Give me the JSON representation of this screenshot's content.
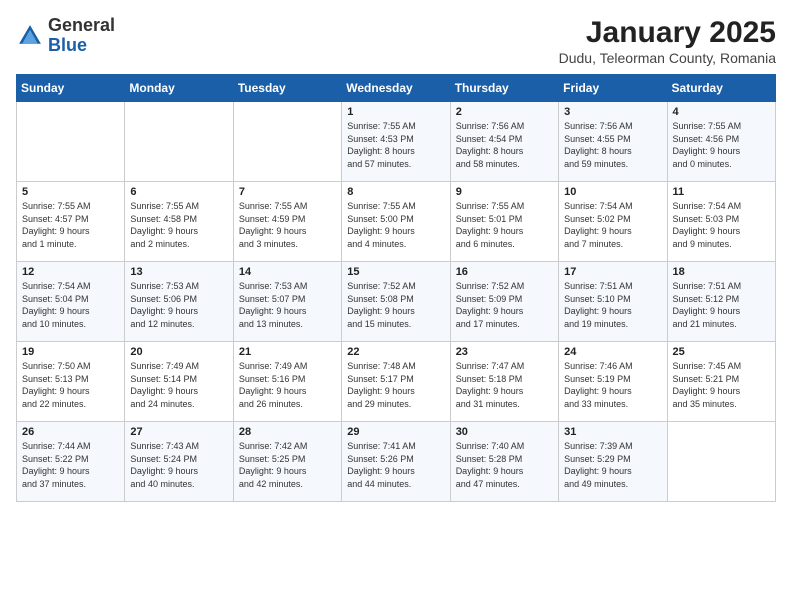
{
  "logo": {
    "general": "General",
    "blue": "Blue"
  },
  "header": {
    "month": "January 2025",
    "location": "Dudu, Teleorman County, Romania"
  },
  "days_of_week": [
    "Sunday",
    "Monday",
    "Tuesday",
    "Wednesday",
    "Thursday",
    "Friday",
    "Saturday"
  ],
  "weeks": [
    [
      {
        "day": "",
        "info": ""
      },
      {
        "day": "",
        "info": ""
      },
      {
        "day": "",
        "info": ""
      },
      {
        "day": "1",
        "info": "Sunrise: 7:55 AM\nSunset: 4:53 PM\nDaylight: 8 hours\nand 57 minutes."
      },
      {
        "day": "2",
        "info": "Sunrise: 7:56 AM\nSunset: 4:54 PM\nDaylight: 8 hours\nand 58 minutes."
      },
      {
        "day": "3",
        "info": "Sunrise: 7:56 AM\nSunset: 4:55 PM\nDaylight: 8 hours\nand 59 minutes."
      },
      {
        "day": "4",
        "info": "Sunrise: 7:55 AM\nSunset: 4:56 PM\nDaylight: 9 hours\nand 0 minutes."
      }
    ],
    [
      {
        "day": "5",
        "info": "Sunrise: 7:55 AM\nSunset: 4:57 PM\nDaylight: 9 hours\nand 1 minute."
      },
      {
        "day": "6",
        "info": "Sunrise: 7:55 AM\nSunset: 4:58 PM\nDaylight: 9 hours\nand 2 minutes."
      },
      {
        "day": "7",
        "info": "Sunrise: 7:55 AM\nSunset: 4:59 PM\nDaylight: 9 hours\nand 3 minutes."
      },
      {
        "day": "8",
        "info": "Sunrise: 7:55 AM\nSunset: 5:00 PM\nDaylight: 9 hours\nand 4 minutes."
      },
      {
        "day": "9",
        "info": "Sunrise: 7:55 AM\nSunset: 5:01 PM\nDaylight: 9 hours\nand 6 minutes."
      },
      {
        "day": "10",
        "info": "Sunrise: 7:54 AM\nSunset: 5:02 PM\nDaylight: 9 hours\nand 7 minutes."
      },
      {
        "day": "11",
        "info": "Sunrise: 7:54 AM\nSunset: 5:03 PM\nDaylight: 9 hours\nand 9 minutes."
      }
    ],
    [
      {
        "day": "12",
        "info": "Sunrise: 7:54 AM\nSunset: 5:04 PM\nDaylight: 9 hours\nand 10 minutes."
      },
      {
        "day": "13",
        "info": "Sunrise: 7:53 AM\nSunset: 5:06 PM\nDaylight: 9 hours\nand 12 minutes."
      },
      {
        "day": "14",
        "info": "Sunrise: 7:53 AM\nSunset: 5:07 PM\nDaylight: 9 hours\nand 13 minutes."
      },
      {
        "day": "15",
        "info": "Sunrise: 7:52 AM\nSunset: 5:08 PM\nDaylight: 9 hours\nand 15 minutes."
      },
      {
        "day": "16",
        "info": "Sunrise: 7:52 AM\nSunset: 5:09 PM\nDaylight: 9 hours\nand 17 minutes."
      },
      {
        "day": "17",
        "info": "Sunrise: 7:51 AM\nSunset: 5:10 PM\nDaylight: 9 hours\nand 19 minutes."
      },
      {
        "day": "18",
        "info": "Sunrise: 7:51 AM\nSunset: 5:12 PM\nDaylight: 9 hours\nand 21 minutes."
      }
    ],
    [
      {
        "day": "19",
        "info": "Sunrise: 7:50 AM\nSunset: 5:13 PM\nDaylight: 9 hours\nand 22 minutes."
      },
      {
        "day": "20",
        "info": "Sunrise: 7:49 AM\nSunset: 5:14 PM\nDaylight: 9 hours\nand 24 minutes."
      },
      {
        "day": "21",
        "info": "Sunrise: 7:49 AM\nSunset: 5:16 PM\nDaylight: 9 hours\nand 26 minutes."
      },
      {
        "day": "22",
        "info": "Sunrise: 7:48 AM\nSunset: 5:17 PM\nDaylight: 9 hours\nand 29 minutes."
      },
      {
        "day": "23",
        "info": "Sunrise: 7:47 AM\nSunset: 5:18 PM\nDaylight: 9 hours\nand 31 minutes."
      },
      {
        "day": "24",
        "info": "Sunrise: 7:46 AM\nSunset: 5:19 PM\nDaylight: 9 hours\nand 33 minutes."
      },
      {
        "day": "25",
        "info": "Sunrise: 7:45 AM\nSunset: 5:21 PM\nDaylight: 9 hours\nand 35 minutes."
      }
    ],
    [
      {
        "day": "26",
        "info": "Sunrise: 7:44 AM\nSunset: 5:22 PM\nDaylight: 9 hours\nand 37 minutes."
      },
      {
        "day": "27",
        "info": "Sunrise: 7:43 AM\nSunset: 5:24 PM\nDaylight: 9 hours\nand 40 minutes."
      },
      {
        "day": "28",
        "info": "Sunrise: 7:42 AM\nSunset: 5:25 PM\nDaylight: 9 hours\nand 42 minutes."
      },
      {
        "day": "29",
        "info": "Sunrise: 7:41 AM\nSunset: 5:26 PM\nDaylight: 9 hours\nand 44 minutes."
      },
      {
        "day": "30",
        "info": "Sunrise: 7:40 AM\nSunset: 5:28 PM\nDaylight: 9 hours\nand 47 minutes."
      },
      {
        "day": "31",
        "info": "Sunrise: 7:39 AM\nSunset: 5:29 PM\nDaylight: 9 hours\nand 49 minutes."
      },
      {
        "day": "",
        "info": ""
      }
    ]
  ]
}
